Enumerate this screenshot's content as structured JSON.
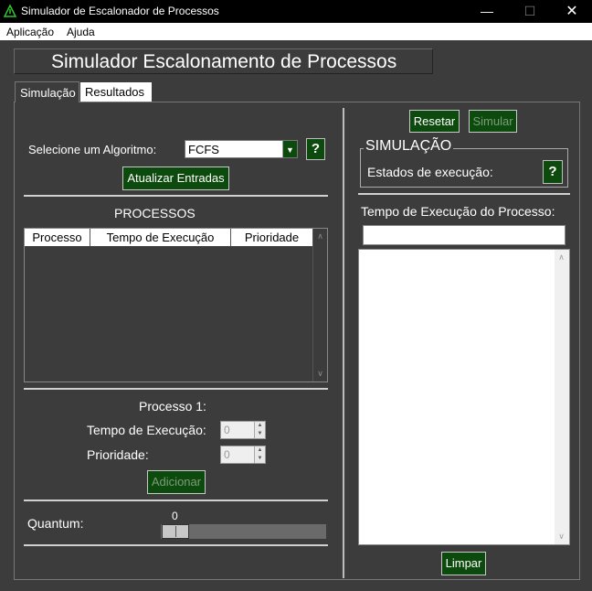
{
  "window": {
    "title": "Simulador de Escalonador de Processos",
    "minimize_glyph": "—",
    "maximize_glyph": "☐",
    "close_glyph": "✕"
  },
  "menu": {
    "items": [
      "Aplicação",
      "Ajuda"
    ]
  },
  "header": {
    "title": "Simulador Escalonamento de Processos"
  },
  "tabs": [
    {
      "label": "Simulação",
      "active": true
    },
    {
      "label": "Resultados",
      "active": false
    }
  ],
  "left": {
    "algorithm_label": "Selecione um Algoritmo:",
    "algorithm_value": "FCFS",
    "combo_arrow": "▼",
    "help_glyph": "?",
    "update_button": "Atualizar Entradas",
    "processes_title": "PROCESSOS",
    "table_columns": [
      "Processo",
      "Tempo de Execução",
      "Prioridade"
    ],
    "table_rows": [],
    "process_heading": "Processo 1:",
    "exec_time_label": "Tempo de Execução:",
    "exec_time_value": "0",
    "priority_label": "Prioridade:",
    "priority_value": "0",
    "add_button": "Adicionar",
    "quantum_label": "Quantum:",
    "quantum_value": "0",
    "quantum_level": 0
  },
  "right": {
    "reset_button": "Resetar",
    "simulate_button": "Simular",
    "simulation_group_title": "SIMULAÇÃO",
    "exec_states_label": "Estados de execução:",
    "help_glyph": "?",
    "process_exec_time_label": "Tempo de Execução do Processo:",
    "process_exec_time_value": "",
    "output_text": "",
    "clear_button": "Limpar"
  },
  "scroll": {
    "up": "∧",
    "down": "∨"
  },
  "colors": {
    "client_bg": "#3c3c3c",
    "button_green": "#0d4a0d",
    "titlebar_bg": "#000000",
    "icon_green": "#2ec82e"
  }
}
